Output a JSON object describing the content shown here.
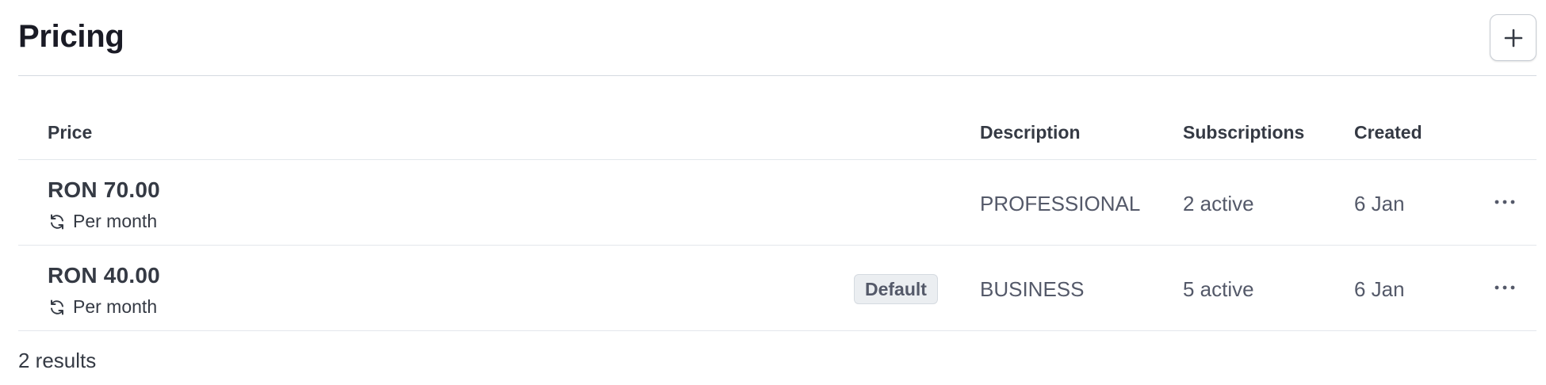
{
  "header": {
    "title": "Pricing",
    "add_icon": "plus-icon"
  },
  "table": {
    "columns": {
      "price": "Price",
      "description": "Description",
      "subscriptions": "Subscriptions",
      "created": "Created"
    },
    "rows": [
      {
        "amount": "RON 70.00",
        "interval": "Per month",
        "interval_icon": "recurring-icon",
        "badge": "",
        "description": "PROFESSIONAL",
        "subscriptions": "2 active",
        "created": "6 Jan",
        "menu_icon": "more-horizontal-icon"
      },
      {
        "amount": "RON 40.00",
        "interval": "Per month",
        "interval_icon": "recurring-icon",
        "badge": "Default",
        "description": "BUSINESS",
        "subscriptions": "5 active",
        "created": "6 Jan",
        "menu_icon": "more-horizontal-icon"
      }
    ]
  },
  "footer": {
    "results": "2 results"
  },
  "colors": {
    "text_primary": "#1a1b25",
    "text_secondary": "#545969",
    "border": "#e3e7ec",
    "badge_bg": "#ebeef1"
  }
}
